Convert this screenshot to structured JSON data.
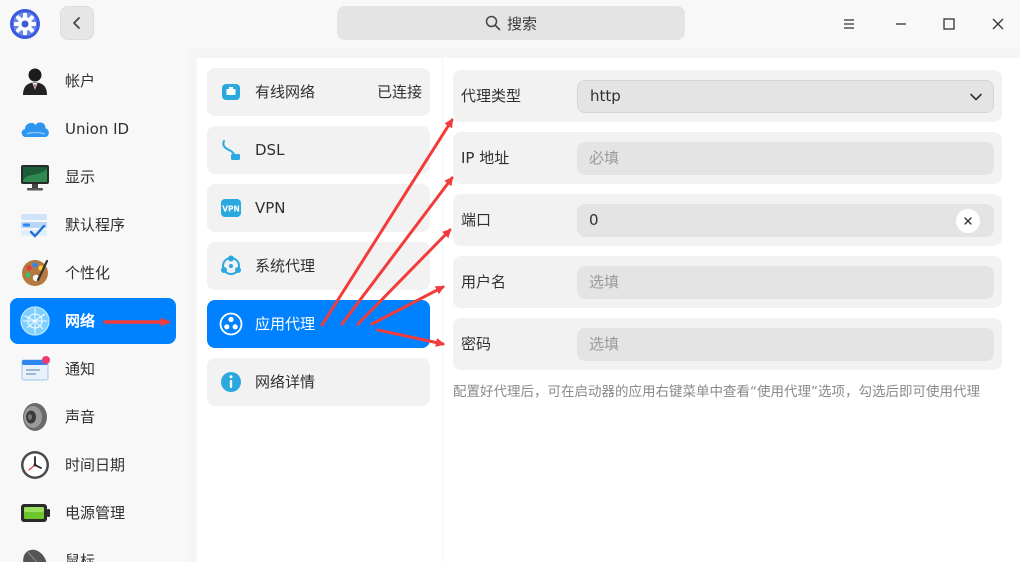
{
  "titlebar": {
    "search_placeholder": "搜索",
    "icons": {
      "logo": "settings-gear-logo",
      "back": "chevron-left-icon",
      "search": "search-icon",
      "menu": "menu-icon",
      "minimize": "minimize-icon",
      "maximize": "maximize-icon",
      "close": "close-icon"
    }
  },
  "sidebar": {
    "items": [
      {
        "label": "帐户",
        "icon": "account-icon"
      },
      {
        "label": "Union ID",
        "icon": "cloud-icon"
      },
      {
        "label": "显示",
        "icon": "display-icon"
      },
      {
        "label": "默认程序",
        "icon": "default-apps-icon"
      },
      {
        "label": "个性化",
        "icon": "palette-icon"
      },
      {
        "label": "网络",
        "icon": "network-globe-icon",
        "active": true
      },
      {
        "label": "通知",
        "icon": "notification-icon"
      },
      {
        "label": "声音",
        "icon": "speaker-icon"
      },
      {
        "label": "时间日期",
        "icon": "clock-icon"
      },
      {
        "label": "电源管理",
        "icon": "battery-icon"
      },
      {
        "label": "鼠标",
        "icon": "mouse-icon"
      }
    ]
  },
  "network_menu": {
    "items": [
      {
        "label": "有线网络",
        "status": "已连接",
        "icon": "wired-network-icon"
      },
      {
        "label": "DSL",
        "icon": "dsl-icon"
      },
      {
        "label": "VPN",
        "icon": "vpn-icon"
      },
      {
        "label": "系统代理",
        "icon": "system-proxy-icon"
      },
      {
        "label": "应用代理",
        "icon": "app-proxy-icon",
        "active": true
      },
      {
        "label": "网络详情",
        "icon": "info-icon"
      }
    ]
  },
  "proxy_form": {
    "type": {
      "label": "代理类型",
      "value": "http"
    },
    "ip": {
      "label": "IP 地址",
      "placeholder": "必填"
    },
    "port": {
      "label": "端口",
      "value": "0"
    },
    "username": {
      "label": "用户名",
      "placeholder": "选填"
    },
    "password": {
      "label": "密码",
      "placeholder": "选填"
    },
    "hint": "配置好代理后，可在启动器的应用右键菜单中查看“使用代理”选项，勾选后即可使用代理"
  },
  "colors": {
    "accent": "#0081ff",
    "annotation_arrow": "#f23b3b"
  }
}
